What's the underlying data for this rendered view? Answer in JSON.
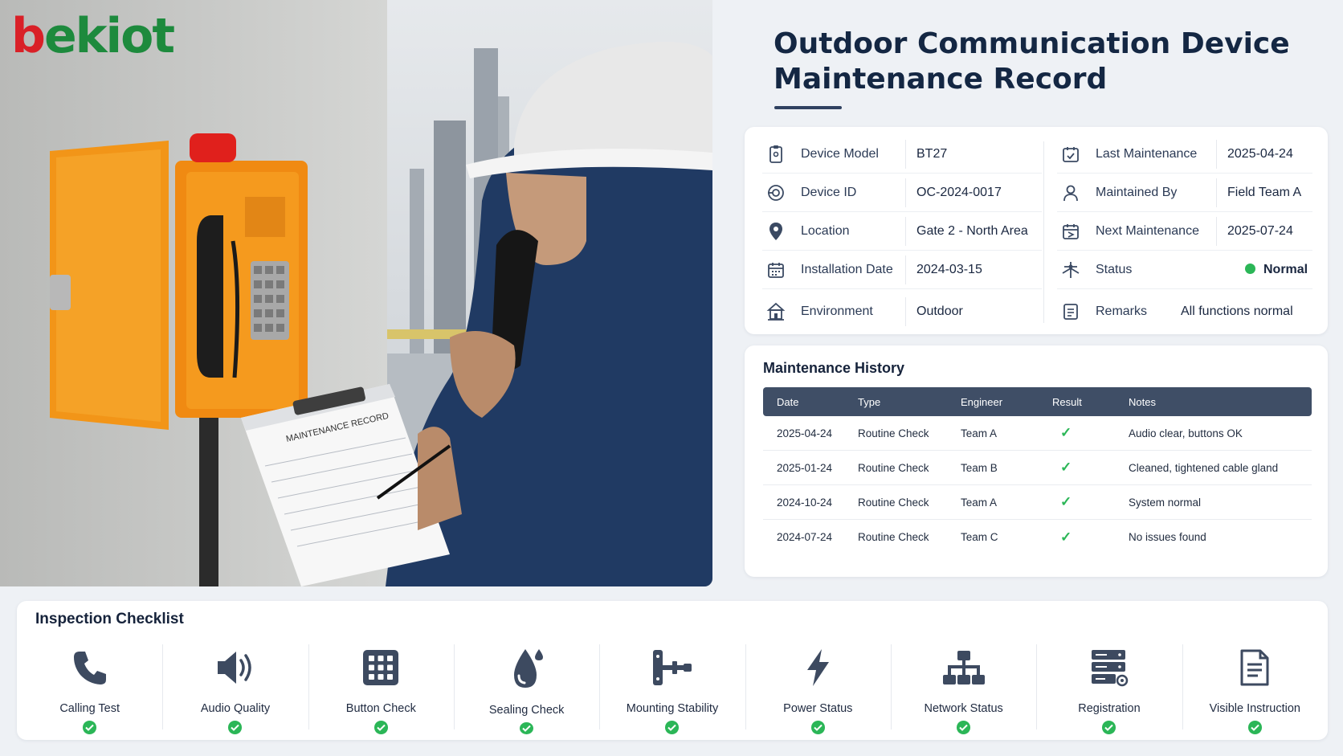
{
  "brand": {
    "logo_mark": "b",
    "logo_rest": "ekiot"
  },
  "photo": {
    "clipboard_heading": "MAINTENANCE RECORD"
  },
  "title": {
    "line1": "Outdoor Communication Device",
    "line2": "Maintenance Record"
  },
  "info": {
    "left": [
      {
        "icon": "device-model-icon",
        "label": "Device Model",
        "value": "BT27"
      },
      {
        "icon": "device-id-icon",
        "label": "Device ID",
        "value": "OC-2024-0017"
      },
      {
        "icon": "location-pin-icon",
        "label": "Location",
        "value": "Gate 2 - North Area"
      },
      {
        "icon": "calendar-icon",
        "label": "Installation Date",
        "value": "2024-03-15"
      },
      {
        "icon": "environment-icon",
        "label": "Environment",
        "value": "Outdoor"
      }
    ],
    "right": [
      {
        "icon": "calendar-check-icon",
        "label": "Last Maintenance",
        "value": "2025-04-24"
      },
      {
        "icon": "person-icon",
        "label": "Maintained By",
        "value": "Field Team A"
      },
      {
        "icon": "calendar-next-icon",
        "label": "Next Maintenance",
        "value": "2025-07-24"
      },
      {
        "icon": "status-icon",
        "label": "Status",
        "value": "Normal",
        "status_color": "#2bb657"
      },
      {
        "icon": "remarks-icon",
        "label": "Remarks",
        "value": "All functions normal"
      }
    ]
  },
  "history": {
    "title": "Maintenance History",
    "columns": [
      "Date",
      "Type",
      "Engineer",
      "Result",
      "Notes"
    ],
    "rows": [
      {
        "date": "2025-04-24",
        "type": "Routine Check",
        "engineer": "Team A",
        "result": "✓",
        "notes": "Audio clear, buttons OK"
      },
      {
        "date": "2025-01-24",
        "type": "Routine Check",
        "engineer": "Team B",
        "result": "✓",
        "notes": "Cleaned, tightened cable gland"
      },
      {
        "date": "2024-10-24",
        "type": "Routine Check",
        "engineer": "Team A",
        "result": "✓",
        "notes": "System normal"
      },
      {
        "date": "2024-07-24",
        "type": "Routine Check",
        "engineer": "Team C",
        "result": "✓",
        "notes": "No issues found"
      }
    ]
  },
  "checklist": {
    "title": "Inspection Checklist",
    "items": [
      {
        "icon": "phone-icon",
        "label": "Calling Test",
        "passed": true
      },
      {
        "icon": "speaker-icon",
        "label": "Audio Quality",
        "passed": true
      },
      {
        "icon": "keypad-icon",
        "label": "Button Check",
        "passed": true
      },
      {
        "icon": "water-drop-icon",
        "label": "Sealing Check",
        "passed": true
      },
      {
        "icon": "mount-icon",
        "label": "Mounting Stability",
        "passed": true
      },
      {
        "icon": "lightning-icon",
        "label": "Power Status",
        "passed": true
      },
      {
        "icon": "network-icon",
        "label": "Network Status",
        "passed": true
      },
      {
        "icon": "server-icon",
        "label": "Registration",
        "passed": true
      },
      {
        "icon": "document-icon",
        "label": "Visible Instruction",
        "passed": true
      }
    ]
  },
  "colors": {
    "accent_green": "#2bb657",
    "navy": "#142743",
    "table_header": "#3f4e66",
    "brand_green": "#1d8a3d",
    "brand_red": "#d92027"
  }
}
